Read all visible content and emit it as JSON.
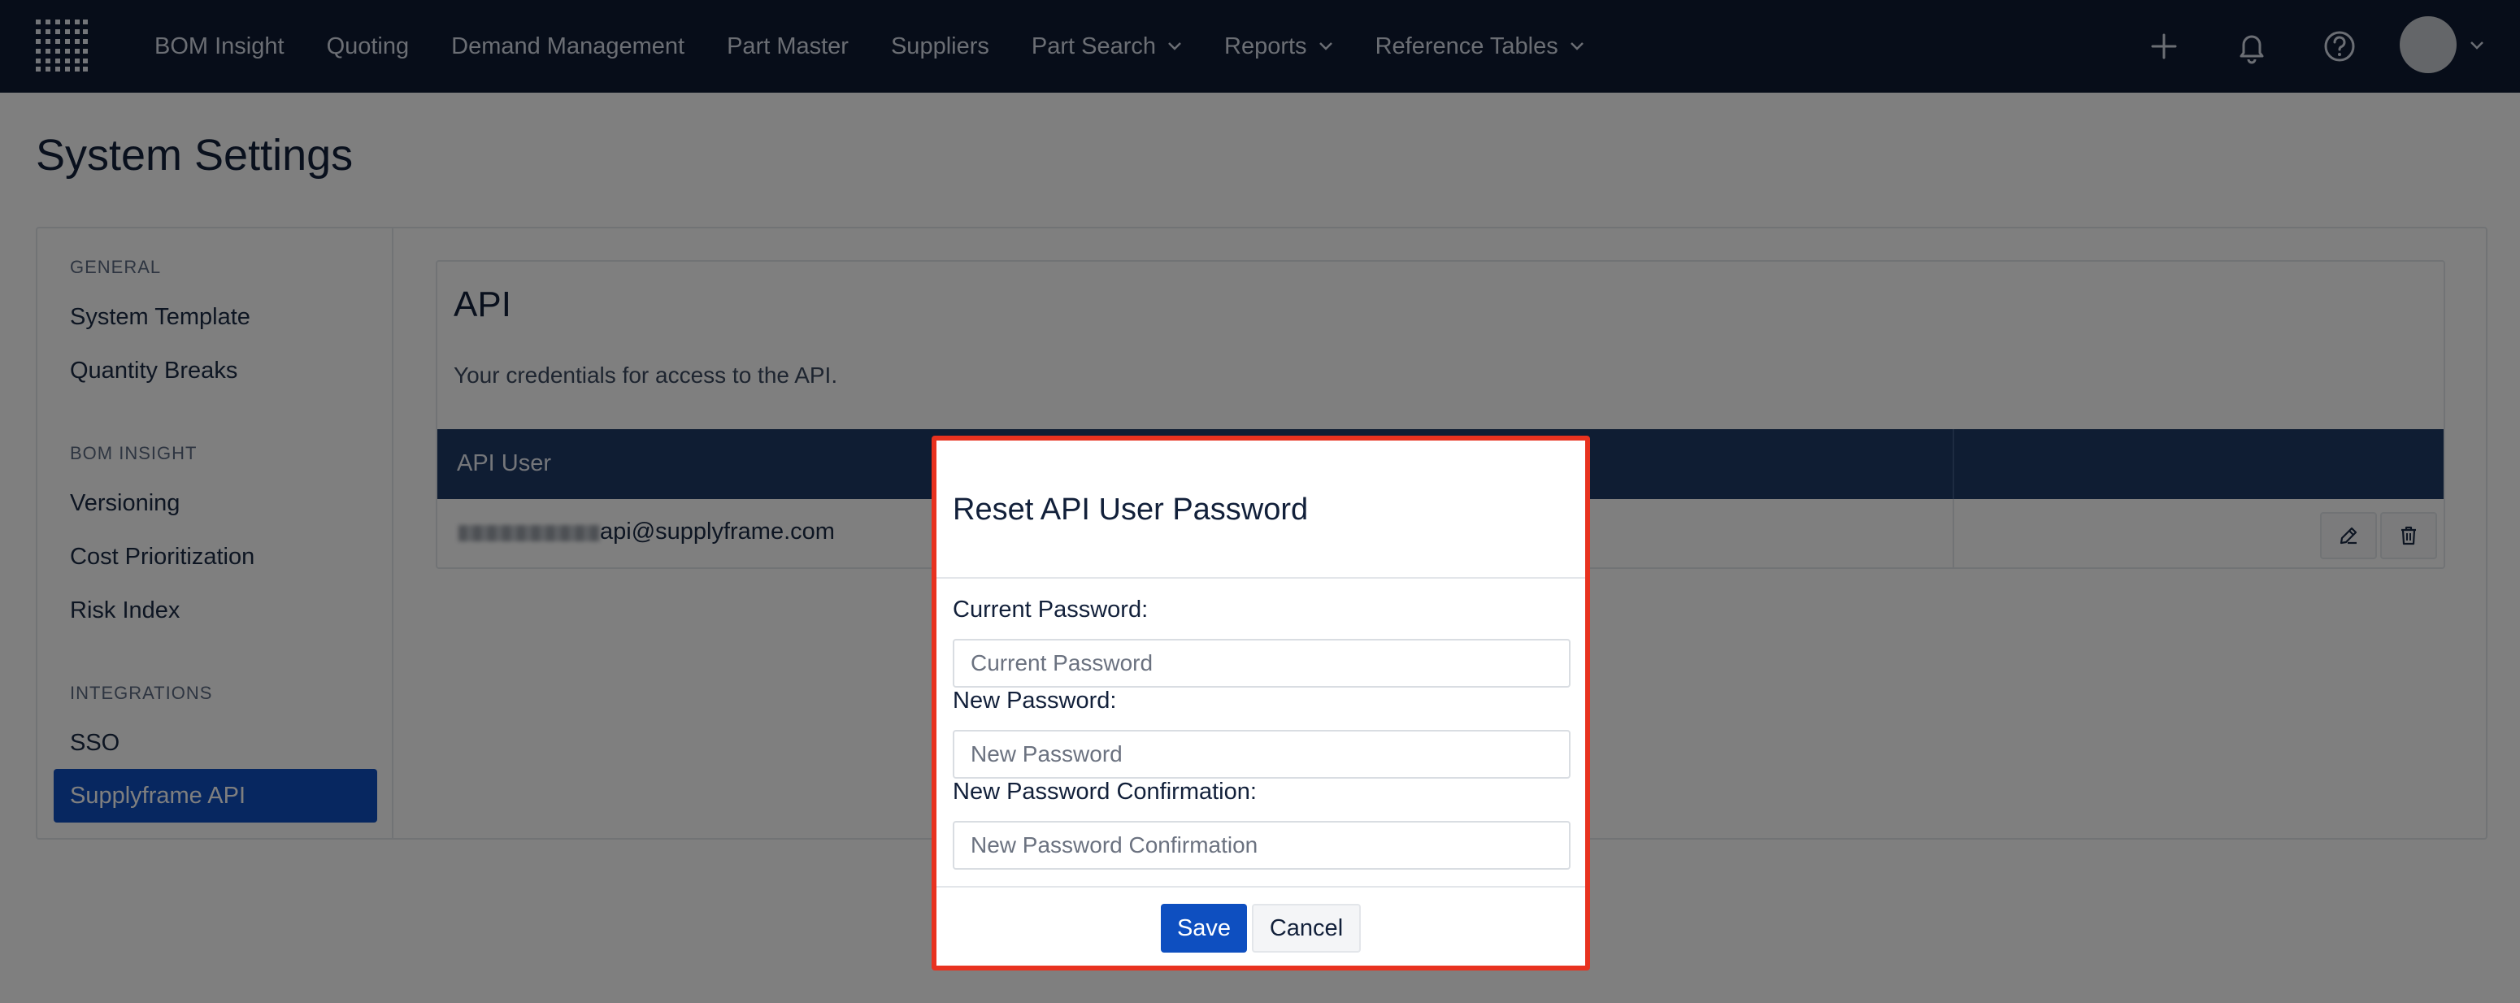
{
  "nav": {
    "items": [
      {
        "label": "BOM Insight",
        "has_dropdown": false
      },
      {
        "label": "Quoting",
        "has_dropdown": false
      },
      {
        "label": "Demand Management",
        "has_dropdown": false
      },
      {
        "label": "Part Master",
        "has_dropdown": false
      },
      {
        "label": "Suppliers",
        "has_dropdown": false
      },
      {
        "label": "Part Search",
        "has_dropdown": true
      },
      {
        "label": "Reports",
        "has_dropdown": true
      },
      {
        "label": "Reference Tables",
        "has_dropdown": true
      }
    ],
    "icons": [
      "plus-icon",
      "bell-icon",
      "help-icon",
      "avatar",
      "chevron-down-icon"
    ]
  },
  "page": {
    "title": "System Settings"
  },
  "sidebar": {
    "sections": [
      {
        "heading": "GENERAL",
        "items": [
          "System Template",
          "Quantity Breaks"
        ]
      },
      {
        "heading": "BOM INSIGHT",
        "items": [
          "Versioning",
          "Cost Prioritization",
          "Risk Index"
        ]
      },
      {
        "heading": "INTEGRATIONS",
        "items": [
          "SSO",
          "Supplyframe API"
        ]
      }
    ],
    "active_item": "Supplyframe API"
  },
  "api_panel": {
    "title": "API",
    "description": "Your credentials for access to the API.",
    "table": {
      "columns": [
        "API User",
        ""
      ],
      "rows": [
        {
          "user_email_visible": "api@supplyframe.com",
          "actions": [
            "edit-icon",
            "trash-icon"
          ]
        }
      ]
    }
  },
  "modal": {
    "title": "Reset API User Password",
    "fields": [
      {
        "label": "Current Password:",
        "placeholder": "Current Password",
        "value": ""
      },
      {
        "label": "New Password:",
        "placeholder": "New Password",
        "value": ""
      },
      {
        "label": "New Password Confirmation:",
        "placeholder": "New Password Confirmation",
        "value": ""
      }
    ],
    "save_label": "Save",
    "cancel_label": "Cancel"
  },
  "colors": {
    "nav_bg": "#0f1b33",
    "accent": "#0e4fc0",
    "table_header": "#1f3a66",
    "highlight_border": "#e8321f"
  }
}
